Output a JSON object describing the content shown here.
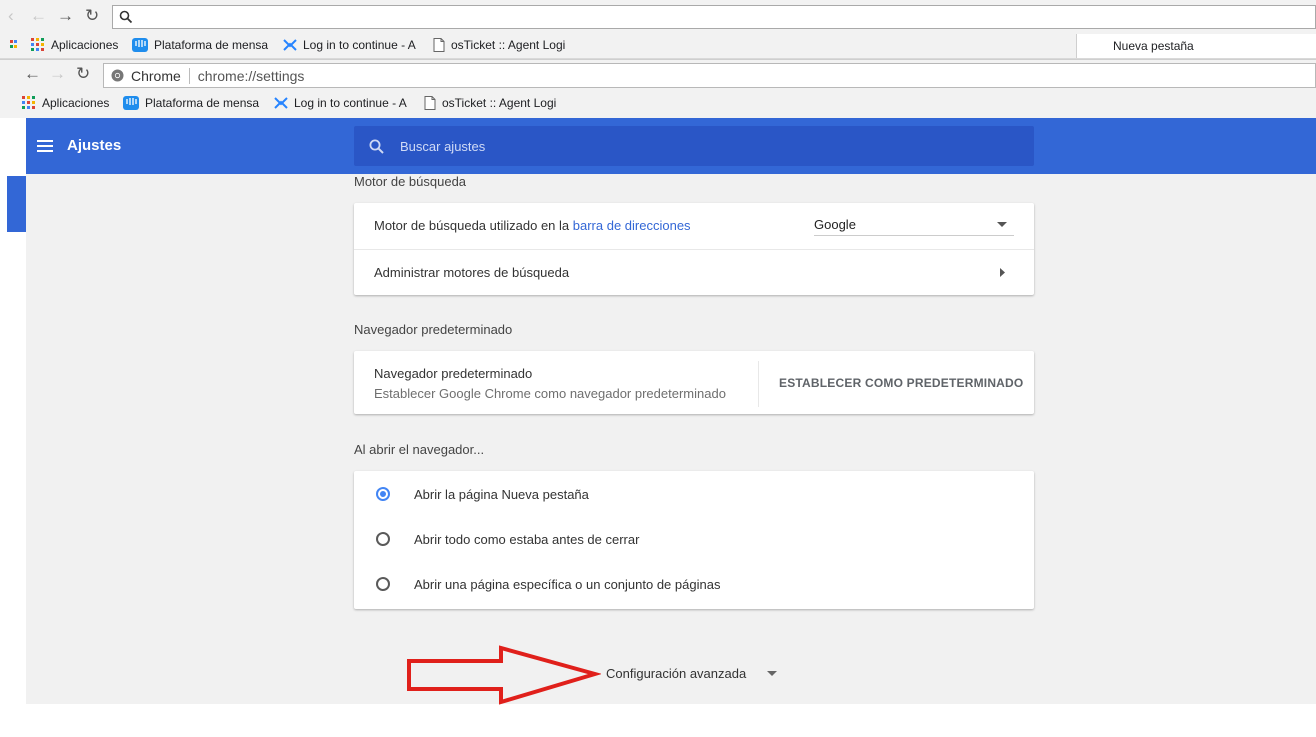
{
  "outer_browser": {
    "address_value": "",
    "bookmarks": [
      "Aplicaciones",
      "Plataforma de mensa",
      "Log in to continue - A",
      "osTicket :: Agent Logi"
    ],
    "tab_label": "Nueva pestaña"
  },
  "inner_browser": {
    "site_label": "Chrome",
    "url": "chrome://settings",
    "bookmarks": [
      "Aplicaciones",
      "Plataforma de mensa",
      "Log in to continue - A",
      "osTicket :: Agent Logi"
    ]
  },
  "header": {
    "title": "Ajustes",
    "search_placeholder": "Buscar ajustes"
  },
  "search_engine": {
    "section_title": "Motor de búsqueda",
    "row1_label_prefix": "Motor de búsqueda utilizado en la",
    "row1_link": "barra de direcciones",
    "row1_value": "Google",
    "row2_label": "Administrar motores de búsqueda"
  },
  "default_browser": {
    "section_title": "Navegador predeterminado",
    "title": "Navegador predeterminado",
    "subtitle": "Establecer Google Chrome como navegador predeterminado",
    "button": "ESTABLECER COMO PREDETERMINADO"
  },
  "on_startup": {
    "section_title": "Al abrir el navegador...",
    "options": [
      {
        "label": "Abrir la página Nueva pestaña",
        "checked": true
      },
      {
        "label": "Abrir todo como estaba antes de cerrar",
        "checked": false
      },
      {
        "label": "Abrir una página específica o un conjunto de páginas",
        "checked": false
      }
    ]
  },
  "advanced": {
    "label": "Configuración avanzada"
  },
  "colors": {
    "header_blue": "#3367d6",
    "accent_blue": "#4285f4",
    "annotation_red": "#e0201b"
  }
}
